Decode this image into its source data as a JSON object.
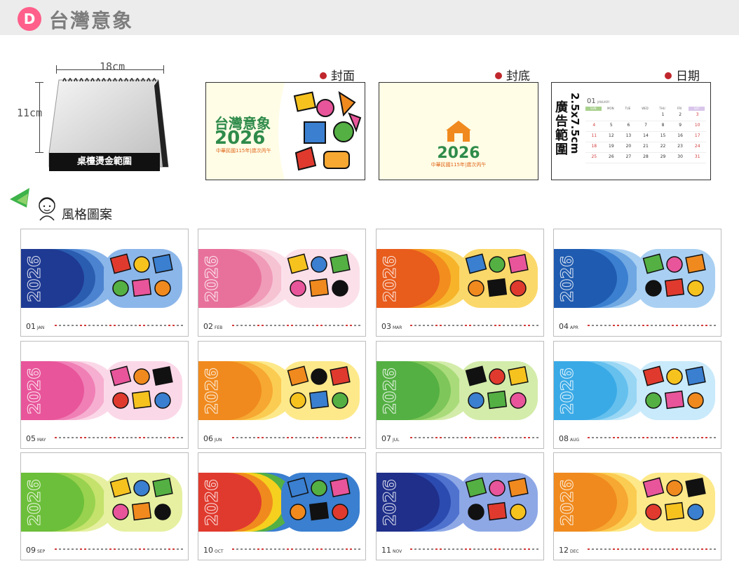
{
  "header": {
    "badge": "D",
    "title": "台灣意象"
  },
  "product": {
    "width_label": "18cm",
    "height_label": "11cm",
    "band_label": "桌檯燙金範圍"
  },
  "cover": {
    "label": "封面",
    "title": "台灣意象",
    "year": "2026",
    "subtitle": "中華民國115年|歲次丙午"
  },
  "back": {
    "label": "封底",
    "year": "2026",
    "subtitle": "中華民國115年|歲次丙午"
  },
  "date_panel": {
    "label": "日期",
    "ad_text": "廣告範圍",
    "ad_size": "2.5x7.5cm",
    "month_num": "01",
    "month_name": "JANUARY",
    "weekdays": [
      "SUN",
      "MON",
      "TUE",
      "WED",
      "THU",
      "FRI",
      "SAT"
    ],
    "weeks": [
      [
        "",
        "",
        "",
        "",
        "1",
        "2",
        "3"
      ],
      [
        "4",
        "5",
        "6",
        "7",
        "8",
        "9",
        "10"
      ],
      [
        "11",
        "12",
        "13",
        "14",
        "15",
        "16",
        "17"
      ],
      [
        "18",
        "19",
        "20",
        "21",
        "22",
        "23",
        "24"
      ],
      [
        "25",
        "26",
        "27",
        "28",
        "29",
        "30",
        "31"
      ]
    ]
  },
  "style_section": {
    "title": "風格圖案"
  },
  "year_text": "2026",
  "months": [
    {
      "num": "01",
      "abbr": "JAN",
      "colors": [
        "#1f3a93",
        "#2a5db0",
        "#4c83d0",
        "#8bb6ea"
      ]
    },
    {
      "num": "02",
      "abbr": "FEB",
      "colors": [
        "#e8719b",
        "#f09bb8",
        "#f6c3d3",
        "#fbe0ea"
      ]
    },
    {
      "num": "03",
      "abbr": "MAR",
      "colors": [
        "#e85c1c",
        "#f28d1e",
        "#f7b42a",
        "#fbd86a"
      ]
    },
    {
      "num": "04",
      "abbr": "APR",
      "colors": [
        "#1f5bb0",
        "#3b7fd0",
        "#6fa7e3",
        "#a9d0f2"
      ]
    },
    {
      "num": "05",
      "abbr": "MAY",
      "colors": [
        "#e8559a",
        "#f07fb6",
        "#f6afd0",
        "#fbd8e8"
      ]
    },
    {
      "num": "06",
      "abbr": "JUN",
      "colors": [
        "#f08a1e",
        "#f6a832",
        "#fbcc52",
        "#fde98a"
      ]
    },
    {
      "num": "07",
      "abbr": "JUL",
      "colors": [
        "#54b043",
        "#7fc65a",
        "#aadb7a",
        "#d3ecaa"
      ]
    },
    {
      "num": "08",
      "abbr": "AUG",
      "colors": [
        "#3aaae6",
        "#65c0ee",
        "#98d6f4",
        "#c9eafa"
      ]
    },
    {
      "num": "09",
      "abbr": "SEP",
      "colors": [
        "#6cbf3a",
        "#98d24e",
        "#c4e26c",
        "#e6f0a0"
      ]
    },
    {
      "num": "10",
      "abbr": "OCT",
      "colors": [
        "#e03a2e",
        "#f08a1e",
        "#f6d01e",
        "#54b043",
        "#3a7fd0"
      ]
    },
    {
      "num": "11",
      "abbr": "NOV",
      "colors": [
        "#1f2f8a",
        "#2c4bb0",
        "#4f72cf",
        "#8ea8e6"
      ]
    },
    {
      "num": "12",
      "abbr": "DEC",
      "colors": [
        "#f08a1e",
        "#f6a832",
        "#fbcc52",
        "#fde98a"
      ]
    }
  ]
}
